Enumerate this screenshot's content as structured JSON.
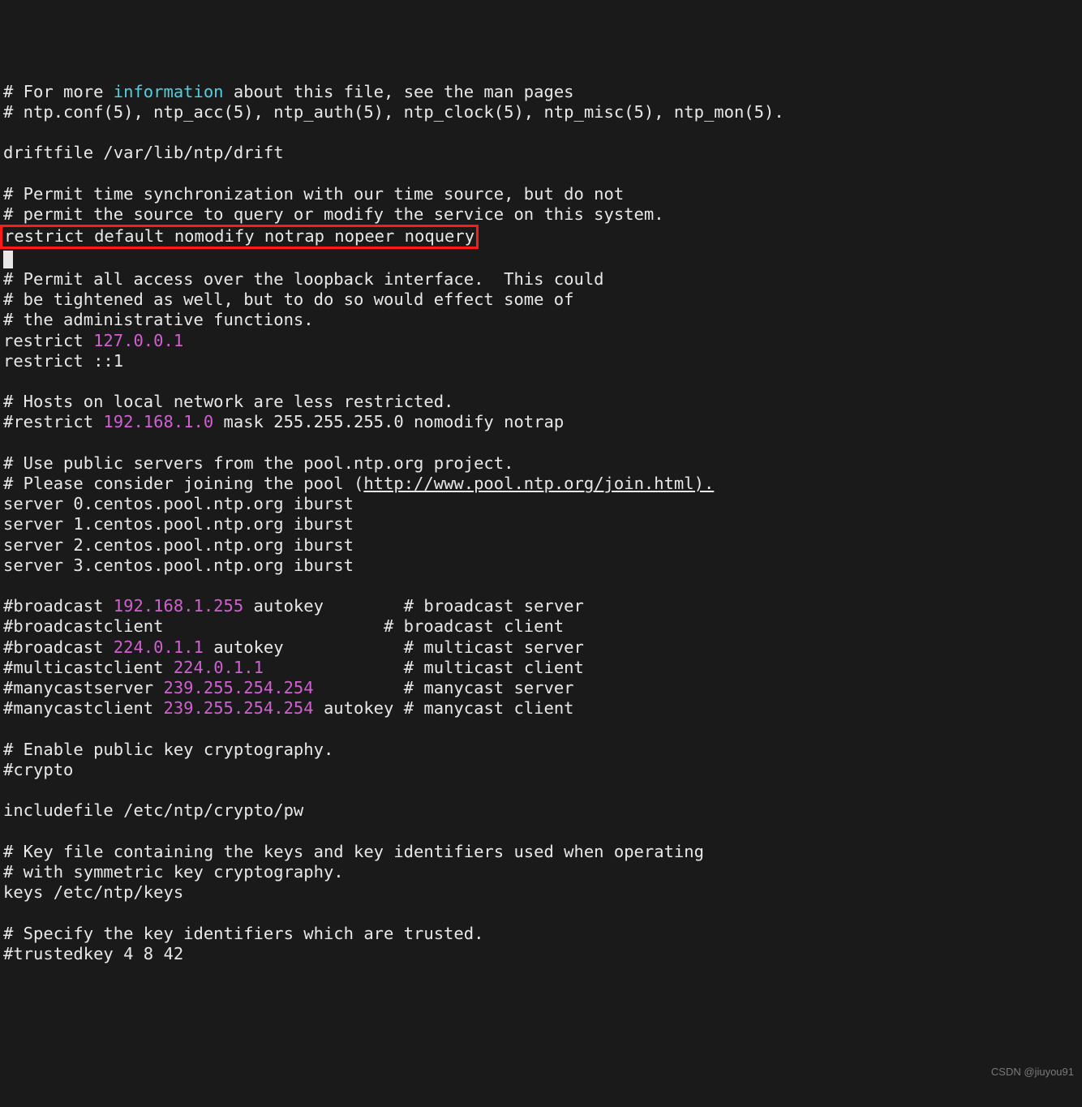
{
  "lines": {
    "l1a": "# For more ",
    "l1b": "information",
    "l1c": " about this file, see the man pages",
    "l2": "# ntp.conf(5), ntp_acc(5), ntp_auth(5), ntp_clock(5), ntp_misc(5), ntp_mon(5).",
    "l3": "",
    "l4": "driftfile /var/lib/ntp/drift",
    "l5": "",
    "l6": "# Permit time synchronization with our time source, but do not",
    "l7": "# permit the source to query or modify the service on this system.",
    "l8": "restrict default nomodify notrap nopeer noquery",
    "l9": "",
    "l10": "# Permit all access over the loopback interface.  This could",
    "l11": "# be tightened as well, but to do so would effect some of",
    "l12": "# the administrative functions.",
    "l13a": "restrict ",
    "l13b": "127.0.0.1",
    "l14": "restrict ::1",
    "l15": "",
    "l16": "# Hosts on local network are less restricted.",
    "l17a": "#restrict ",
    "l17b": "192.168.1.0",
    "l17c": " mask 255.255.255.0 nomodify notrap",
    "l18": "",
    "l19": "# Use public servers from the pool.ntp.org project.",
    "l20a": "# Please consider joining the pool (",
    "l20b": "http://www.pool.ntp.org/join.html).",
    "l21": "server 0.centos.pool.ntp.org iburst",
    "l22": "server 1.centos.pool.ntp.org iburst",
    "l23": "server 2.centos.pool.ntp.org iburst",
    "l24": "server 3.centos.pool.ntp.org iburst",
    "l25": "",
    "l26a": "#broadcast ",
    "l26b": "192.168.1.255",
    "l26c": " autokey        # broadcast server",
    "l27": "#broadcastclient                      # broadcast client",
    "l28a": "#broadcast ",
    "l28b": "224.0.1.1",
    "l28c": " autokey            # multicast server",
    "l29a": "#multicastclient ",
    "l29b": "224.0.1.1",
    "l29c": "              # multicast client",
    "l30a": "#manycastserver ",
    "l30b": "239.255.254.254",
    "l30c": "         # manycast server",
    "l31a": "#manycastclient ",
    "l31b": "239.255.254.254",
    "l31c": " autokey # manycast client",
    "l32": "",
    "l33": "# Enable public key cryptography.",
    "l34": "#crypto",
    "l35": "",
    "l36": "includefile /etc/ntp/crypto/pw",
    "l37": "",
    "l38": "# Key file containing the keys and key identifiers used when operating",
    "l39": "# with symmetric key cryptography.",
    "l40": "keys /etc/ntp/keys",
    "l41": "",
    "l42": "# Specify the key identifiers which are trusted.",
    "l43": "#trustedkey 4 8 42"
  },
  "watermark": "CSDN @jiuyou91"
}
